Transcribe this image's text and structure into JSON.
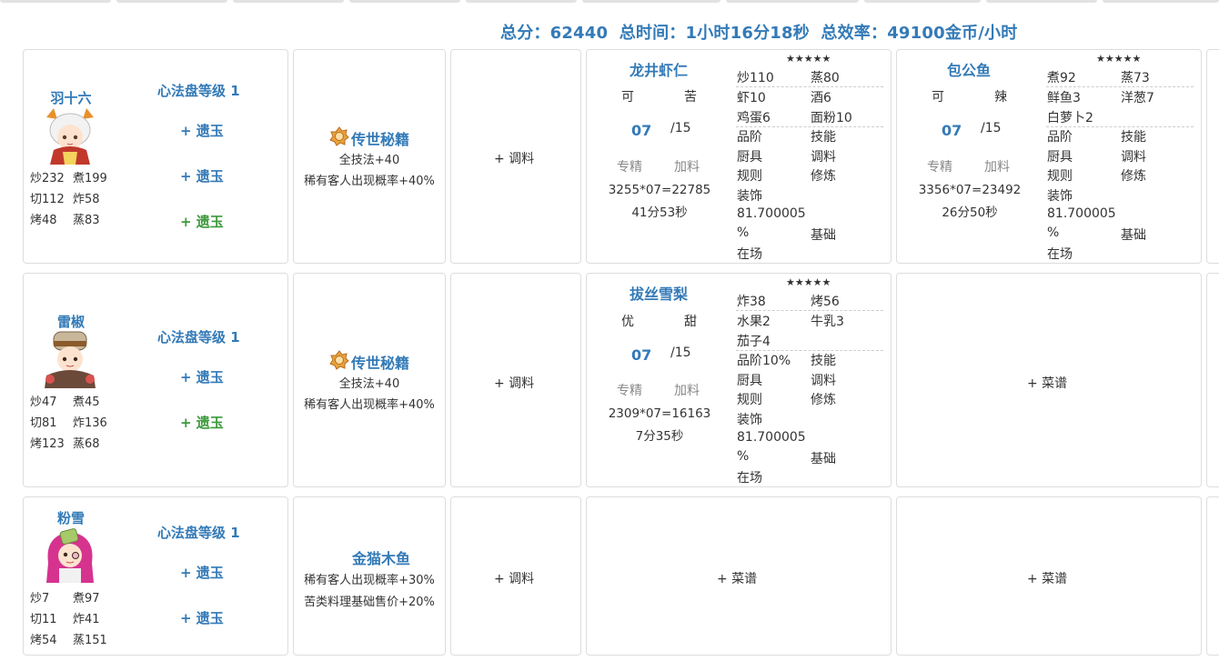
{
  "summary": {
    "total_score": "总分：62440",
    "total_time": "总时间：1小时16分18秒",
    "total_efficiency": "总效率：49100金币/小时"
  },
  "common": {
    "heart_level": "心法盘等级 1",
    "relic": "+ 遗玉",
    "add_seasoning": "+ 调料",
    "add_recipe": "+ 菜谱",
    "zhuanjing": "专精",
    "jialiao": "加料",
    "qty_max": "/15"
  },
  "rows": [
    {
      "chef": {
        "name": "羽十六",
        "avatar_icon": "chef-avatar-yushiliu-icon",
        "stats": [
          "炒232",
          "煮199",
          "切112",
          "炸58",
          "烤48",
          "蒸83"
        ]
      },
      "equip": {
        "icon": "book-icon",
        "name": "传世秘籍",
        "lines": [
          "全技法+40",
          "稀有客人出现概率+40%"
        ]
      },
      "recipes": [
        {
          "name": "龙井虾仁",
          "attr1": "可",
          "attr2": "苦",
          "qty": "07",
          "calc": "3255*07=22785",
          "time": "41分53秒",
          "stars": "★★★★★",
          "skills": [
            "炒110",
            "蒸80"
          ],
          "ingredients": [
            "虾10",
            "酒6",
            "鸡蛋6",
            "面粉10"
          ],
          "info": [
            "品阶",
            "技能",
            "厨具",
            "调料",
            "规则",
            "修炼"
          ],
          "deco": "装饰",
          "deco_value": "81.700005",
          "percent": "%",
          "base": "基础",
          "onsite": "在场"
        },
        {
          "name": "包公鱼",
          "attr1": "可",
          "attr2": "辣",
          "qty": "07",
          "calc": "3356*07=23492",
          "time": "26分50秒",
          "stars": "★★★★★",
          "skills": [
            "煮92",
            "蒸73"
          ],
          "ingredients": [
            "鲜鱼3",
            "洋葱7",
            "白萝卜2"
          ],
          "info": [
            "品阶",
            "技能",
            "厨具",
            "调料",
            "规则",
            "修炼"
          ],
          "deco": "装饰",
          "deco_value": "81.700005",
          "percent": "%",
          "base": "基础",
          "onsite": "在场"
        }
      ]
    },
    {
      "chef": {
        "name": "雷椒",
        "avatar_icon": "chef-avatar-leijiao-icon",
        "stats": [
          "炒47",
          "煮45",
          "切81",
          "炸136",
          "烤123",
          "蒸68"
        ]
      },
      "equip": {
        "icon": "book-icon",
        "name": "传世秘籍",
        "lines": [
          "全技法+40",
          "稀有客人出现概率+40%"
        ]
      },
      "recipes": [
        {
          "name": "拔丝雪梨",
          "attr1": "优",
          "attr2": "甜",
          "qty": "07",
          "calc": "2309*07=16163",
          "time": "7分35秒",
          "stars": "★★★★★",
          "skills": [
            "炸38",
            "烤56"
          ],
          "ingredients": [
            "水果2",
            "牛乳3",
            "茄子4"
          ],
          "info": [
            "品阶10%",
            "技能",
            "厨具",
            "调料",
            "规则",
            "修炼"
          ],
          "deco": "装饰",
          "deco_value": "81.700005",
          "percent": "%",
          "base": "基础",
          "onsite": "在场"
        }
      ]
    },
    {
      "chef": {
        "name": "粉雪",
        "avatar_icon": "chef-avatar-fenxue-icon",
        "stats": [
          "炒7",
          "煮97",
          "切11",
          "炸41",
          "烤54",
          "蒸151"
        ]
      },
      "equip": {
        "name": "金猫木鱼",
        "lines": [
          "稀有客人出现概率+30%",
          "苦类料理基础售价+20%"
        ]
      }
    }
  ]
}
